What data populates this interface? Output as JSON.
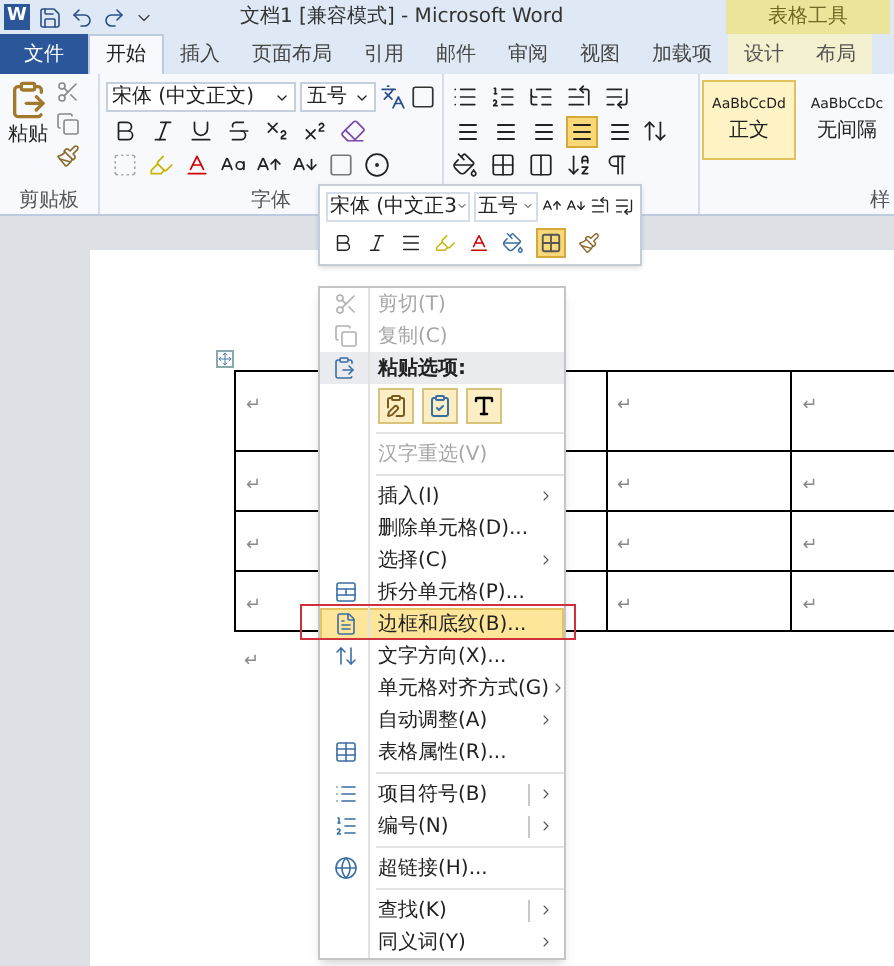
{
  "title_bar": {
    "app_letter": "W",
    "title": "文档1 [兼容模式] - Microsoft Word",
    "contextual_group": "表格工具"
  },
  "tabs": [
    {
      "label": "文件",
      "kind": "file",
      "selected": false
    },
    {
      "label": "开始",
      "kind": "normal",
      "selected": true
    },
    {
      "label": "插入",
      "kind": "normal",
      "selected": false
    },
    {
      "label": "页面布局",
      "kind": "normal",
      "selected": false
    },
    {
      "label": "引用",
      "kind": "normal",
      "selected": false
    },
    {
      "label": "邮件",
      "kind": "normal",
      "selected": false
    },
    {
      "label": "审阅",
      "kind": "normal",
      "selected": false
    },
    {
      "label": "视图",
      "kind": "normal",
      "selected": false
    },
    {
      "label": "加载项",
      "kind": "normal",
      "selected": false
    },
    {
      "label": "设计",
      "kind": "contextual",
      "selected": false
    },
    {
      "label": "布局",
      "kind": "contextual",
      "selected": false
    }
  ],
  "ribbon": {
    "clipboard": {
      "paste_label": "粘贴",
      "group_label": "剪贴板"
    },
    "font": {
      "font_name": "宋体 (中文正文)",
      "font_size": "五号",
      "group_label": "字体"
    },
    "paragraph": {
      "align_buttons": [
        {
          "selected": false
        },
        {
          "selected": false
        },
        {
          "selected": false
        },
        {
          "selected": true
        },
        {
          "selected": false
        }
      ]
    },
    "styles": {
      "items": [
        {
          "sample": "AaBbCcDd",
          "name": "正文",
          "selected": true
        },
        {
          "sample": "AaBbCcDc",
          "name": "无间隔",
          "selected": false
        }
      ],
      "group_label": "样"
    }
  },
  "mini_toolbar": {
    "font_name": "宋体 (中文正3",
    "font_size": "五号",
    "borders_button": {
      "selected": true
    }
  },
  "table": {
    "rows": [
      [
        "↵",
        "↵",
        "↵"
      ],
      [
        "↵",
        "↵",
        "↵"
      ],
      [
        "↵",
        "↵",
        "↵"
      ],
      [
        "↵",
        "↵",
        "↵"
      ]
    ]
  },
  "after_table_mark": "↵",
  "context_menu": {
    "items": [
      {
        "kind": "item",
        "label": "剪切(T)",
        "disabled": true,
        "selected": false
      },
      {
        "kind": "item",
        "label": "复制(C)",
        "disabled": true,
        "selected": false
      },
      {
        "kind": "header",
        "label": "粘贴选项:"
      },
      {
        "kind": "paste_options"
      },
      {
        "kind": "separator"
      },
      {
        "kind": "item",
        "label": "汉字重选(V)",
        "disabled": true,
        "selected": false
      },
      {
        "kind": "separator"
      },
      {
        "kind": "item",
        "label": "插入(I)",
        "disabled": false,
        "selected": false,
        "submenu": true
      },
      {
        "kind": "item",
        "label": "删除单元格(D)...",
        "disabled": false,
        "selected": false
      },
      {
        "kind": "item",
        "label": "选择(C)",
        "disabled": false,
        "selected": false,
        "submenu": true
      },
      {
        "kind": "item",
        "label": "拆分单元格(P)...",
        "disabled": false,
        "selected": false
      },
      {
        "kind": "item",
        "label": "边框和底纹(B)...",
        "disabled": false,
        "selected": true
      },
      {
        "kind": "item",
        "label": "文字方向(X)...",
        "disabled": false,
        "selected": false
      },
      {
        "kind": "item",
        "label": "单元格对齐方式(G)",
        "disabled": false,
        "selected": false,
        "submenu": true
      },
      {
        "kind": "item",
        "label": "自动调整(A)",
        "disabled": false,
        "selected": false,
        "submenu": true
      },
      {
        "kind": "item",
        "label": "表格属性(R)...",
        "disabled": false,
        "selected": false
      },
      {
        "kind": "separator"
      },
      {
        "kind": "item",
        "label": "项目符号(B)",
        "disabled": false,
        "selected": false,
        "submenu": true,
        "split": true
      },
      {
        "kind": "item",
        "label": "编号(N)",
        "disabled": false,
        "selected": false,
        "submenu": true,
        "split": true
      },
      {
        "kind": "separator"
      },
      {
        "kind": "item",
        "label": "超链接(H)...",
        "disabled": false,
        "selected": false
      },
      {
        "kind": "separator"
      },
      {
        "kind": "item",
        "label": "查找(K)",
        "disabled": false,
        "selected": false,
        "submenu": true,
        "split": true
      },
      {
        "kind": "item",
        "label": "同义词(Y)",
        "disabled": false,
        "selected": false,
        "submenu": true
      }
    ]
  }
}
